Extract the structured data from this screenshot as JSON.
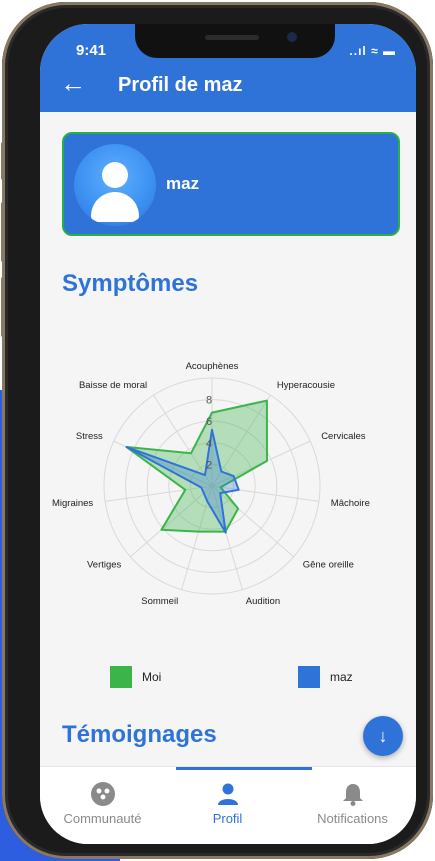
{
  "status_bar": {
    "time": "9:41",
    "icons": "..ıl ≈ ▬"
  },
  "header": {
    "title": "Profil de maz"
  },
  "profile": {
    "username": "maz"
  },
  "sections": {
    "symptoms_title": "Symptômes",
    "testimonials_title": "Témoignages"
  },
  "chart_data": {
    "type": "radar",
    "axes": [
      "Acouphènes",
      "Hyperacousie",
      "Cervicales",
      "Mâchoire",
      "Gêne oreille",
      "Audition",
      "Sommeil",
      "Vertiges",
      "Migraines",
      "Stress",
      "Baisse de moral"
    ],
    "ticks": [
      "2",
      "4",
      "6",
      "8"
    ],
    "rmax": 10,
    "series": [
      {
        "name": "Moi",
        "color": "#3bb54a",
        "values": [
          6.8,
          9.4,
          5.6,
          0.8,
          3.2,
          4.4,
          4.4,
          6.2,
          2.5,
          8.7,
          3.6
        ]
      },
      {
        "name": "maz",
        "color": "#2f73d9",
        "values": [
          5.2,
          1.6,
          2.2,
          2.5,
          1.0,
          4.5,
          1.5,
          1.0,
          1.0,
          8.7,
          1.2
        ]
      }
    ]
  },
  "legend": [
    {
      "label": "Moi",
      "color": "#3bb54a"
    },
    {
      "label": "maz",
      "color": "#2f73d9"
    }
  ],
  "bottom_nav": [
    {
      "label": "Communauté",
      "icon": "community-icon"
    },
    {
      "label": "Profil",
      "icon": "person-icon"
    },
    {
      "label": "Notifications",
      "icon": "bell-icon"
    }
  ]
}
